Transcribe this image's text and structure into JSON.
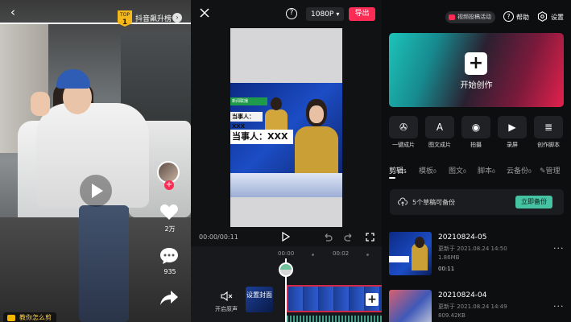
{
  "feed": {
    "rank_badge_top": "TOP",
    "rank_badge_num": "1",
    "rank_label": "抖音飙升榜",
    "like_count": "2万",
    "comment_count": "935",
    "bottom_tag": "教你怎么剪"
  },
  "editor": {
    "resolution": "1080P",
    "export_label": "导出",
    "news_tag": "新闻联播",
    "news_bar_small": "当事人：XXX",
    "news_bar_large": "当事人：XXX",
    "time_readout": "00:00/00:11",
    "ticks": [
      "00:00",
      "00:02"
    ],
    "audio_label": "开启原声",
    "cover_label": "设置封面"
  },
  "home": {
    "promo_label": "视频投稿活动",
    "help_label": "帮助",
    "settings_label": "设置",
    "hero_label": "开始创作",
    "tools": [
      {
        "label": "一键成片",
        "icon": "film-reel-icon"
      },
      {
        "label": "图文成片",
        "icon": "document-a-icon"
      },
      {
        "label": "拍摄",
        "icon": "camera-icon"
      },
      {
        "label": "录屏",
        "icon": "screen-record-icon"
      },
      {
        "label": "创作脚本",
        "icon": "script-icon"
      }
    ],
    "tabs": [
      {
        "label": "剪辑",
        "count": "5"
      },
      {
        "label": "模板",
        "count": "0"
      },
      {
        "label": "图文",
        "count": "0"
      },
      {
        "label": "脚本",
        "count": "0"
      },
      {
        "label": "云备份",
        "count": "0"
      },
      {
        "label": "管理",
        "count": ""
      }
    ],
    "backup_text": "5个草稿可备份",
    "backup_button": "立即备份",
    "drafts": [
      {
        "title": "20210824-05",
        "updated": "更新于 2021.08.24 14:50",
        "size": "1.86MB",
        "duration": "00:11"
      },
      {
        "title": "20210824-04",
        "updated": "更新于 2021.08.24 14:49",
        "size": "809.42KB",
        "duration": ""
      }
    ]
  },
  "colors": {
    "accent_red": "#fe2c55",
    "accent_teal": "#45c3a3",
    "badge_gold": "#f3b81c"
  }
}
